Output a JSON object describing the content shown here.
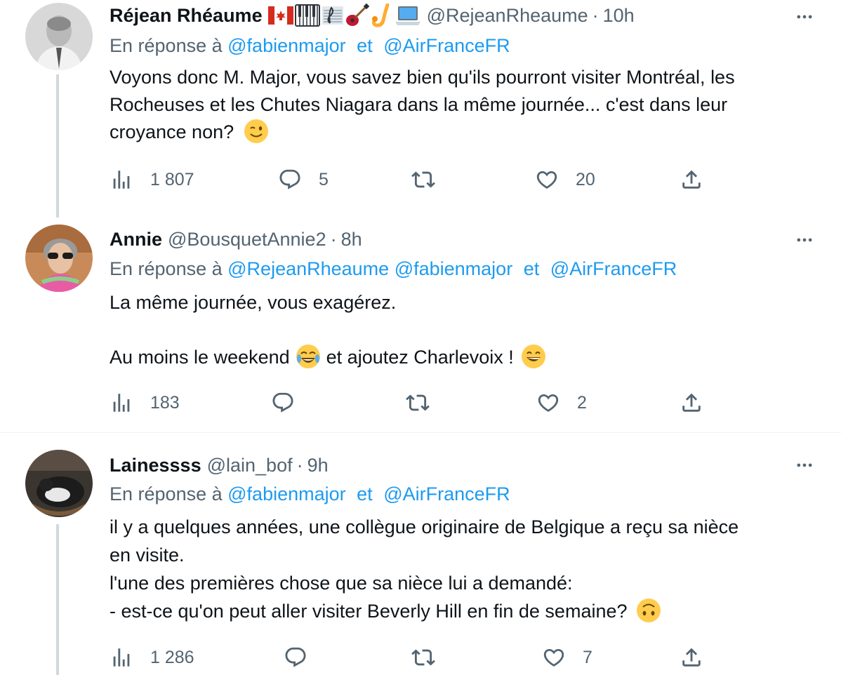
{
  "tweets": [
    {
      "name": "Réjean Rhéaume",
      "badges": [
        "canada-flag-emoji",
        "piano-keys-emoji",
        "sheet-music-emoji",
        "guitar-emoji",
        "saxophone-emoji",
        "laptop-emoji"
      ],
      "handle": "@RejeanRheaume",
      "dot": "·",
      "time": "10h",
      "reply_prefix": "En réponse à",
      "mentions": [
        "@fabienmajor",
        "@AirFranceFR"
      ],
      "et": "et",
      "body": [
        "Voyons donc M. Major, vous savez bien qu'ils pourront visiter Montréal, les",
        "Rocheuses et les Chutes Niagara dans la même journée... c'est dans leur",
        "croyance non?"
      ],
      "emoji": "winking-face",
      "views": "1 807",
      "replies": "5",
      "retweets": "",
      "likes": "20"
    },
    {
      "name": "Annie",
      "handle": "@BousquetAnnie2",
      "dot": "·",
      "time": "8h",
      "reply_prefix": "En réponse à",
      "mentions": [
        "@RejeanRheaume",
        "@fabienmajor",
        "@AirFranceFR"
      ],
      "et": "et",
      "body": [
        "La même journée, vous exagérez.",
        "",
        "Au moins le weekend",
        "et ajoutez Charlevoix !"
      ],
      "emoji": [
        "tears-of-joy",
        "grinning-face"
      ],
      "views": "183",
      "replies": "",
      "retweets": "",
      "likes": "2"
    },
    {
      "name": "Lainessss",
      "handle": "@lain_bof",
      "dot": "·",
      "time": "9h",
      "reply_prefix": "En réponse à",
      "mentions": [
        "@fabienmajor",
        "@AirFranceFR"
      ],
      "et": "et",
      "body": [
        "il y a quelques années, une collègue originaire de Belgique a reçu sa nièce",
        "en visite.",
        "l'une des premières chose que sa nièce lui a demandé:",
        "- est-ce qu'on peut aller visiter Beverly Hill en fin de semaine?"
      ],
      "emoji": "upside-down-face",
      "views": "1 286",
      "replies": "",
      "retweets": "",
      "likes": "7"
    }
  ],
  "colors": {
    "link": "#1d9bf0",
    "secondary": "#536471",
    "text": "#0f1419",
    "thread_line": "#cfd9de"
  }
}
